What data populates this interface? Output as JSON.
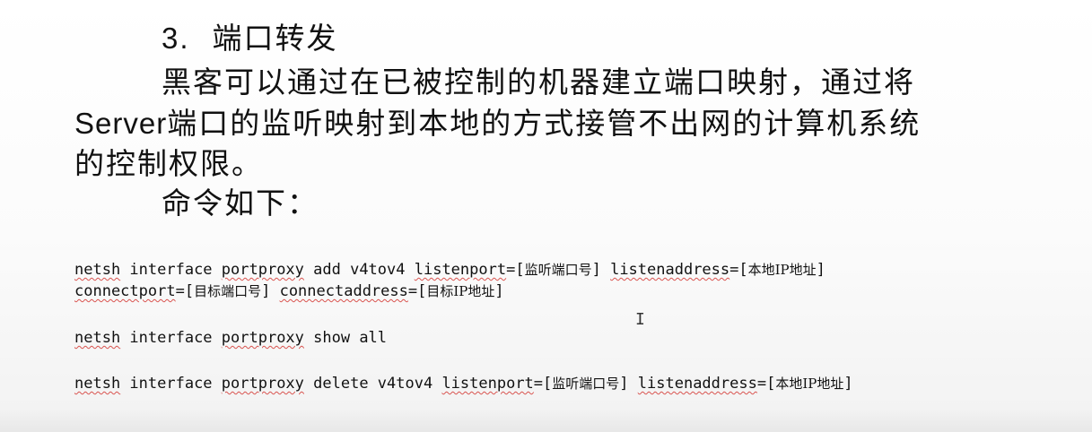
{
  "heading": {
    "number": "3.",
    "title": "端口转发"
  },
  "paragraph": {
    "line1": "黑客可以通过在已被控制的机器建立端口映射，通过将",
    "line2_latin": "Server",
    "line2_rest": "端口的监听映射到本地的方式接管不出网的计算机系统",
    "line3": "的控制权限。"
  },
  "intro": "命令如下：",
  "commands": {
    "add_line1": {
      "cmd": "netsh",
      "t1": " interface ",
      "obj": "portproxy",
      "t2": " add v4tov4 ",
      "p1": "listenport",
      "t3": "=[",
      "v1": "监听端口号",
      "t4": "] ",
      "p2": "listenaddress",
      "t5": "=[",
      "v2": "本地IP地址",
      "t6": "]"
    },
    "add_line2": {
      "p1": "connectport",
      "t1": "=[",
      "v1": "目标端口号",
      "t2": "] ",
      "p2": "connectaddress",
      "t3": "=[",
      "v2": "目标IP地址",
      "t4": "]"
    },
    "show": {
      "cmd": "netsh",
      "t1": " interface ",
      "obj": "portproxy",
      "t2": " show all"
    },
    "delete": {
      "cmd": "netsh",
      "t1": " interface ",
      "obj": "portproxy",
      "t2": " delete v4tov4 ",
      "p1": "listenport",
      "t3": "=[",
      "v1": "监听端口号",
      "t4": "] ",
      "p2": "listenaddress",
      "t5": "=[",
      "v2": "本地IP地址",
      "t6": "]"
    }
  },
  "cursor_glyph": "I",
  "colors": {
    "text": "#111111",
    "spellcheck_underline": "#d9534f"
  }
}
